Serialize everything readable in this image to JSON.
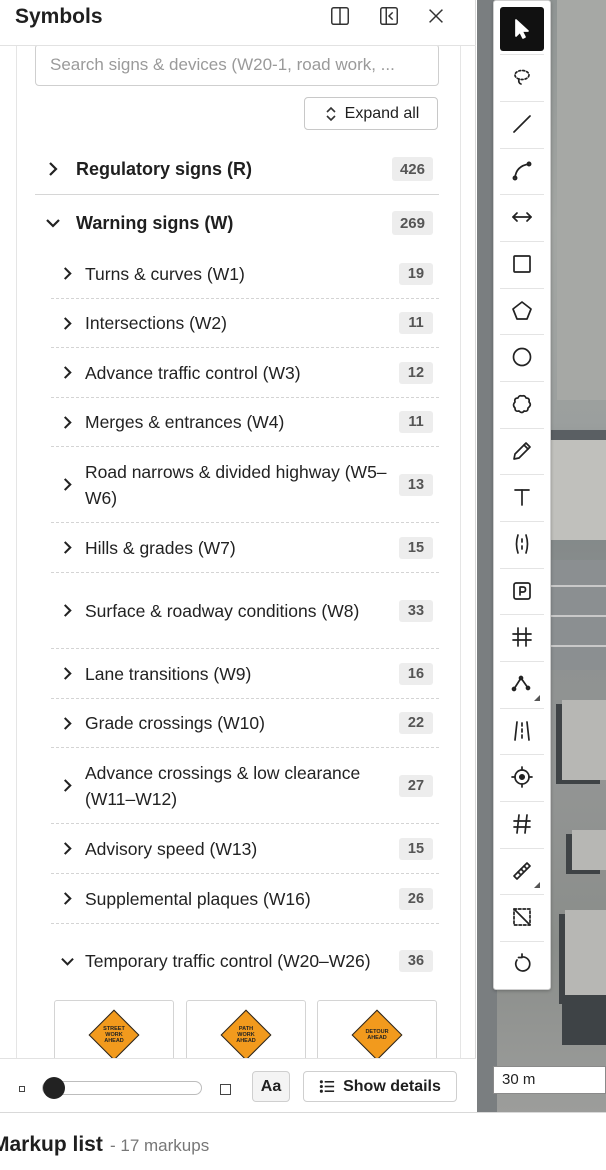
{
  "panel": {
    "title": "Symbols",
    "search_placeholder": "Search signs & devices (W20-1, road work, ...",
    "expand_all_label": "Expand all",
    "categories": [
      {
        "label": "Regulatory signs (R)",
        "count": "426",
        "expanded": false
      },
      {
        "label": "Warning signs (W)",
        "count": "269",
        "expanded": true
      }
    ],
    "subcategories": [
      {
        "label": "Turns & curves (W1)",
        "count": "19"
      },
      {
        "label": "Intersections (W2)",
        "count": "11"
      },
      {
        "label": "Advance traffic control (W3)",
        "count": "12"
      },
      {
        "label": "Merges & entrances (W4)",
        "count": "11"
      },
      {
        "label": "Road narrows & divided highway (W5–W6)",
        "count": "13"
      },
      {
        "label": "Hills & grades (W7)",
        "count": "15"
      },
      {
        "label": "Surface & roadway conditions (W8)",
        "count": "33"
      },
      {
        "label": "Lane transitions (W9)",
        "count": "16"
      },
      {
        "label": "Grade crossings (W10)",
        "count": "22"
      },
      {
        "label": "Advance crossings & low clearance (W11–W12)",
        "count": "27"
      },
      {
        "label": "Advisory speed (W13)",
        "count": "15"
      },
      {
        "label": "Supplemental plaques (W16)",
        "count": "26"
      },
      {
        "label": "Temporary traffic control (W20–W26)",
        "count": "36"
      }
    ],
    "tiles": [
      {
        "text": "STREET WORK AHEAD"
      },
      {
        "text": "PATH WORK AHEAD"
      },
      {
        "text": "DETOUR AHEAD"
      }
    ],
    "footer": {
      "font_button_label": "Aa",
      "show_details_label": "Show details",
      "size_slider_value": 0
    }
  },
  "map": {
    "scale_label": "30 m"
  },
  "markup_list": {
    "title": "Markup list",
    "count_label": "- 17 markups"
  },
  "colors": {
    "sign_orange": "#f29a1d",
    "active_tool": "#111111",
    "badge_bg": "#ededed"
  },
  "tools": [
    "select-arrow-icon",
    "lasso-icon",
    "line-icon",
    "arc-icon",
    "dimension-icon",
    "rectangle-icon",
    "polygon-icon",
    "circle-icon",
    "cloud-icon",
    "pencil-icon",
    "text-icon",
    "lane-icon",
    "parking-icon",
    "crosswalk-icon",
    "polyline-icon",
    "road-lanes-icon",
    "target-icon",
    "rail-icon",
    "measure-icon",
    "crop-icon",
    "rotate-icon"
  ]
}
